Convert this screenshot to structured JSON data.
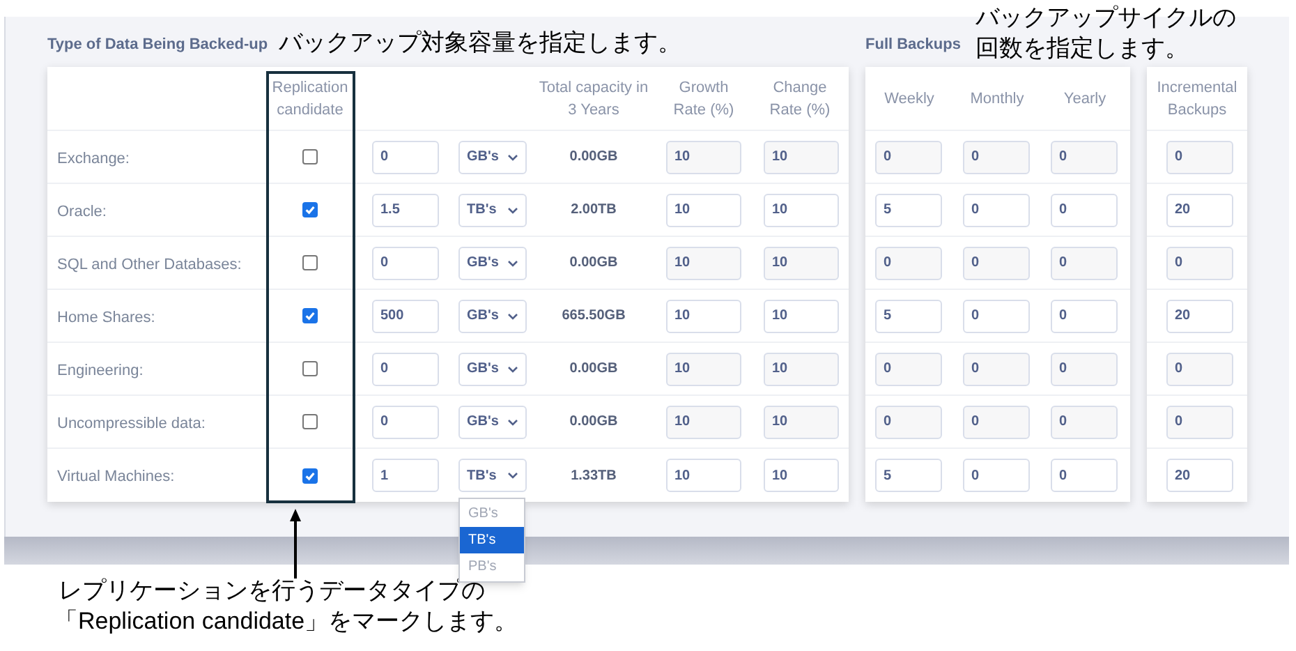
{
  "section_title": "Type of Data Being Backed-up",
  "capacity_note": "バックアップ対象容量を指定します。",
  "full_backups_title": "Full Backups",
  "cycle_note_lines": [
    "バックアップサイクルの",
    "回数を指定します。"
  ],
  "columns": {
    "replication": "Replication candidate",
    "total": "Total capacity in 3 Years",
    "growth": "Growth Rate (%)",
    "change": "Change Rate (%)",
    "weekly": "Weekly",
    "monthly": "Monthly",
    "yearly": "Yearly",
    "incremental": "Incremental Backups"
  },
  "rows": [
    {
      "label": "Exchange:",
      "replication_candidate": false,
      "amount": "0",
      "unit": "GB's",
      "total": "0.00GB",
      "growth_rate": "10",
      "change_rate": "10",
      "weekly": "0",
      "monthly": "0",
      "yearly": "0",
      "incremental": "0"
    },
    {
      "label": "Oracle:",
      "replication_candidate": true,
      "amount": "1.5",
      "unit": "TB's",
      "total": "2.00TB",
      "growth_rate": "10",
      "change_rate": "10",
      "weekly": "5",
      "monthly": "0",
      "yearly": "0",
      "incremental": "20"
    },
    {
      "label": "SQL and Other Databases:",
      "replication_candidate": false,
      "amount": "0",
      "unit": "GB's",
      "total": "0.00GB",
      "growth_rate": "10",
      "change_rate": "10",
      "weekly": "0",
      "monthly": "0",
      "yearly": "0",
      "incremental": "0"
    },
    {
      "label": "Home Shares:",
      "replication_candidate": true,
      "amount": "500",
      "unit": "GB's",
      "total": "665.50GB",
      "growth_rate": "10",
      "change_rate": "10",
      "weekly": "5",
      "monthly": "0",
      "yearly": "0",
      "incremental": "20"
    },
    {
      "label": "Engineering:",
      "replication_candidate": false,
      "amount": "0",
      "unit": "GB's",
      "total": "0.00GB",
      "growth_rate": "10",
      "change_rate": "10",
      "weekly": "0",
      "monthly": "0",
      "yearly": "0",
      "incremental": "0"
    },
    {
      "label": "Uncompressible data:",
      "replication_candidate": false,
      "amount": "0",
      "unit": "GB's",
      "total": "0.00GB",
      "growth_rate": "10",
      "change_rate": "10",
      "weekly": "0",
      "monthly": "0",
      "yearly": "0",
      "incremental": "0"
    },
    {
      "label": "Virtual Machines:",
      "replication_candidate": true,
      "amount": "1",
      "unit": "TB's",
      "total": "1.33TB",
      "growth_rate": "10",
      "change_rate": "10",
      "weekly": "5",
      "monthly": "0",
      "yearly": "0",
      "incremental": "20",
      "unit_menu": [
        {
          "label": "GB's",
          "selected": false
        },
        {
          "label": "TB's",
          "selected": true
        },
        {
          "label": "PB's",
          "selected": false
        }
      ]
    }
  ],
  "note_lines": [
    "レプリケーションを行うデータタイプの",
    "「Replication candidate」をマークします。"
  ]
}
